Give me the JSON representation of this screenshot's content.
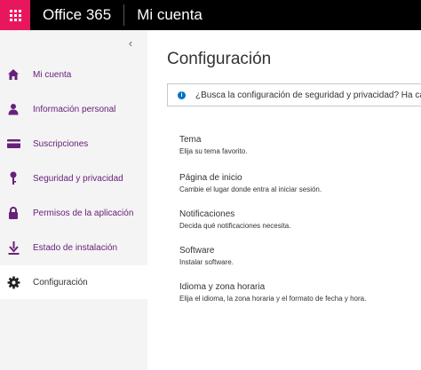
{
  "topbar": {
    "brand": "Office 365",
    "app_title": "Mi cuenta",
    "waffle_icon": "app-launcher-icon",
    "accent_color": "#e8175d"
  },
  "sidebar": {
    "collapse_glyph": "‹",
    "items": [
      {
        "label": "Mi cuenta",
        "icon": "home-icon",
        "active": false
      },
      {
        "label": "Información personal",
        "icon": "person-icon",
        "active": false
      },
      {
        "label": "Suscripciones",
        "icon": "credit-card-icon",
        "active": false
      },
      {
        "label": "Seguridad y privacidad",
        "icon": "key-icon",
        "active": false
      },
      {
        "label": "Permisos de la aplicación",
        "icon": "lock-icon",
        "active": false
      },
      {
        "label": "Estado de instalación",
        "icon": "download-icon",
        "active": false
      },
      {
        "label": "Configuración",
        "icon": "gear-icon",
        "active": true
      }
    ],
    "link_color": "#68217a"
  },
  "main": {
    "title": "Configuración",
    "info_text": "¿Busca la configuración de seguridad y privacidad? Ha ca",
    "info_icon": "info-icon",
    "settings": [
      {
        "title": "Tema",
        "desc": "Elija su tema favorito."
      },
      {
        "title": "Página de inicio",
        "desc": "Cambie el lugar donde entra al iniciar sesión."
      },
      {
        "title": "Notificaciones",
        "desc": "Decida qué notificaciones necesita."
      },
      {
        "title": "Software",
        "desc": "Instalar software."
      },
      {
        "title": "Idioma y zona horaria",
        "desc": "Elija el idioma, la zona horaria y el formato de fecha y hora."
      }
    ]
  }
}
